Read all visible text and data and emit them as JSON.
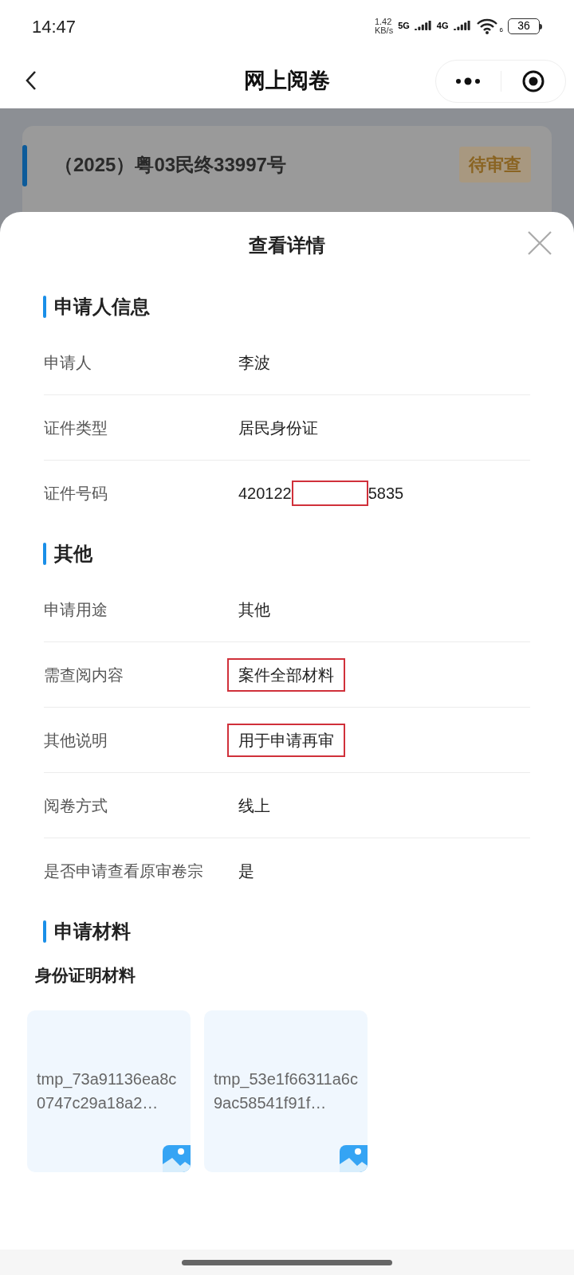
{
  "status_bar": {
    "time": "14:47",
    "speed": "1.42",
    "speed_unit": "KB/s",
    "net1": "5G",
    "net2": "4G",
    "wifi_sub": "6",
    "battery": "36"
  },
  "header": {
    "title": "网上阅卷"
  },
  "background_card": {
    "case_no": "（2025）粤03民终33997号",
    "status": "待审查"
  },
  "sheet": {
    "title": "查看详情",
    "sections": [
      {
        "title": "申请人信息",
        "rows": [
          {
            "label": "申请人",
            "value": "李波",
            "highlighted": false
          },
          {
            "label": "证件类型",
            "value": "居民身份证",
            "highlighted": false
          },
          {
            "label": "证件号码",
            "value": "420122",
            "redacted": true,
            "value_end": "5835",
            "highlighted": false
          }
        ]
      },
      {
        "title": "其他",
        "rows": [
          {
            "label": "申请用途",
            "value": "其他",
            "highlighted": false
          },
          {
            "label": "需查阅内容",
            "value": "案件全部材料",
            "highlighted": true
          },
          {
            "label": "其他说明",
            "value": "用于申请再审",
            "highlighted": true
          },
          {
            "label": "阅卷方式",
            "value": "线上",
            "highlighted": false
          },
          {
            "label": "是否申请查看原审卷宗",
            "value": "是",
            "highlighted": false
          }
        ]
      },
      {
        "title": "申请材料",
        "subtitle": "身份证明材料",
        "files": [
          {
            "name": "tmp_73a91136ea8c0747c29a18a2…"
          },
          {
            "name": "tmp_53e1f66311a6c9ac58541f91f…"
          }
        ]
      }
    ]
  }
}
